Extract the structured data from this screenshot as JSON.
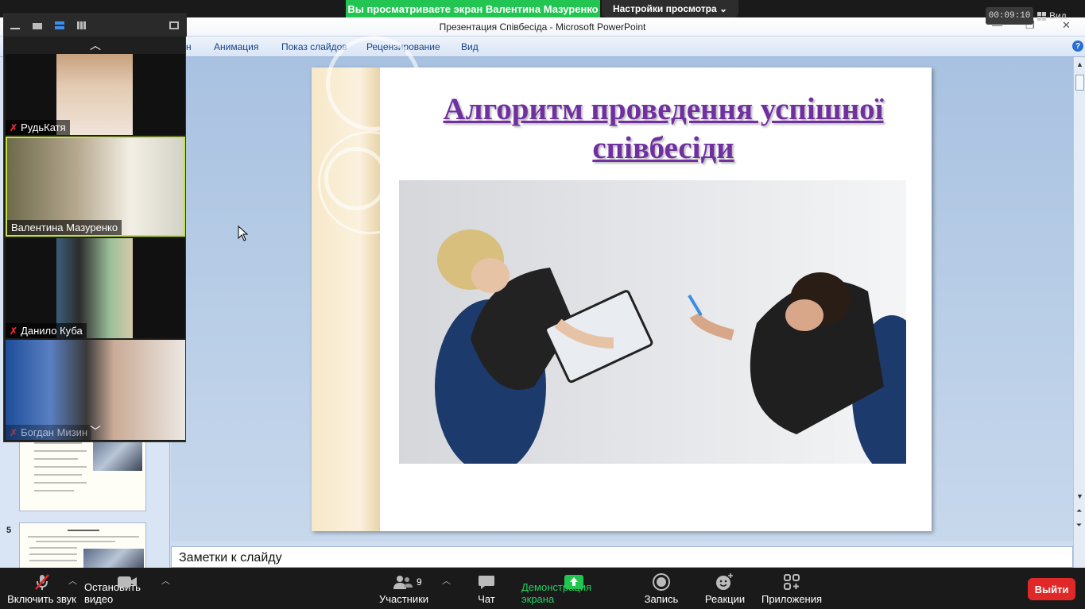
{
  "zoom_top": {
    "share_banner": "Вы просматриваете экран Валентина Мазуренко",
    "view_options": "Настройки просмотра ⌄",
    "timer": "00:09:10",
    "view_label": "Вид"
  },
  "ppt": {
    "window_title": "Презентация Співбесіда - Microsoft PowerPoint",
    "ribbon_tabs": [
      "н",
      "Анимация",
      "Показ слайдов",
      "Рецензирование",
      "Вид"
    ],
    "thumbnails": [
      {
        "number": ""
      },
      {
        "number": "5"
      }
    ],
    "slide_title": "Алгоритм проведення успішної співбесіди",
    "notes_placeholder": "Заметки к слайду"
  },
  "gallery": {
    "participants": [
      {
        "name": "РудьКатя",
        "muted": true
      },
      {
        "name": "Валентина Мазуренко",
        "muted": false,
        "active_speaker": true
      },
      {
        "name": "Данило Куба",
        "muted": true
      },
      {
        "name": "Богдан Мизин",
        "muted": true
      }
    ]
  },
  "toolbar": {
    "mute": "Включить звук",
    "video": "Остановить видео",
    "participants": "Участники",
    "participants_count": "9",
    "chat": "Чат",
    "share": "Демонстрация экрана",
    "record": "Запись",
    "reactions": "Реакции",
    "apps": "Приложения",
    "leave": "Выйти"
  },
  "colors": {
    "share_green": "#23c552",
    "leave_red": "#e02828",
    "title_purple": "#7030a0"
  }
}
